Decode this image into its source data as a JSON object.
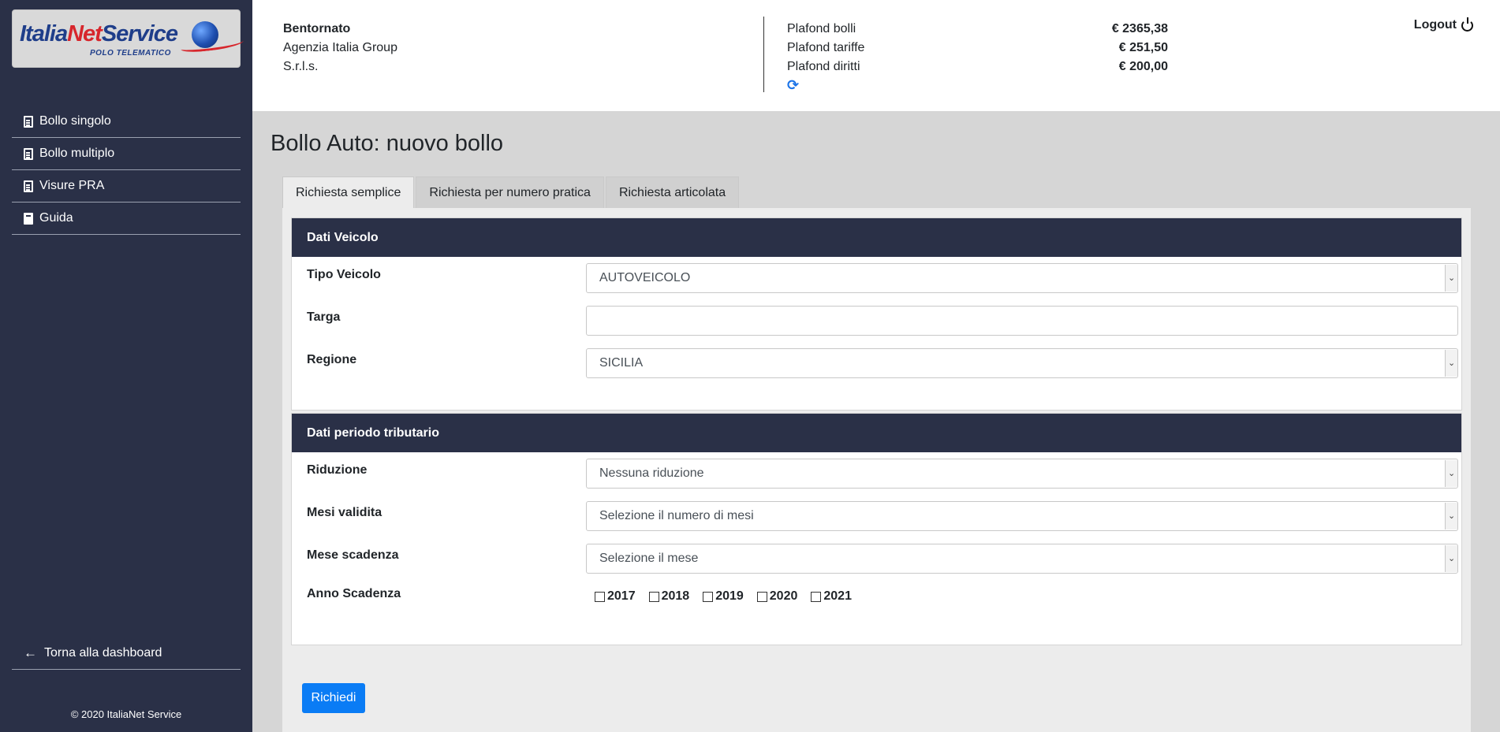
{
  "logo": {
    "brand_part1": "Italia",
    "brand_part2": "Net",
    "brand_part3": "Service",
    "subtitle": "POLO TELEMATICO"
  },
  "sidebar": {
    "items": [
      {
        "label": "Bollo singolo",
        "icon": "document-icon"
      },
      {
        "label": "Bollo multiplo",
        "icon": "document-icon"
      },
      {
        "label": "Visure PRA",
        "icon": "document-icon"
      },
      {
        "label": "Guida",
        "icon": "book-icon"
      }
    ],
    "back_label": "Torna alla dashboard",
    "copyright": "© 2020 ItaliaNet Service"
  },
  "header": {
    "welcome": "Bentornato",
    "agency_line1": "Agenzia Italia Group",
    "agency_line2": "S.r.l.s.",
    "plafond": [
      {
        "label": "Plafond bolli",
        "value": "€ 2365,38"
      },
      {
        "label": "Plafond tariffe",
        "value": "€ 251,50"
      },
      {
        "label": "Plafond diritti",
        "value": "€ 200,00"
      }
    ],
    "logout_label": "Logout",
    "accent_color": "#1a73e8"
  },
  "main": {
    "title": "Bollo Auto: nuovo bollo",
    "tabs": [
      {
        "label": "Richiesta semplice",
        "active": true
      },
      {
        "label": "Richiesta per numero pratica",
        "active": false
      },
      {
        "label": "Richiesta articolata",
        "active": false
      }
    ],
    "section_vehicle": {
      "title": "Dati Veicolo",
      "tipo_label": "Tipo Veicolo",
      "tipo_value": "AUTOVEICOLO",
      "targa_label": "Targa",
      "targa_value": "",
      "regione_label": "Regione",
      "regione_value": "SICILIA"
    },
    "section_period": {
      "title": "Dati periodo tributario",
      "riduzione_label": "Riduzione",
      "riduzione_value": "Nessuna riduzione",
      "mesi_label": "Mesi validita",
      "mesi_value": "Selezione il numero di mesi",
      "scadenza_label": "Mese scadenza",
      "scadenza_value": "Selezione il mese",
      "anno_label": "Anno Scadenza",
      "years": [
        "2017",
        "2018",
        "2019",
        "2020",
        "2021"
      ]
    },
    "submit_label": "Richiedi",
    "primary_color": "#0a7cf5",
    "panel_header_color": "#2a3047"
  }
}
